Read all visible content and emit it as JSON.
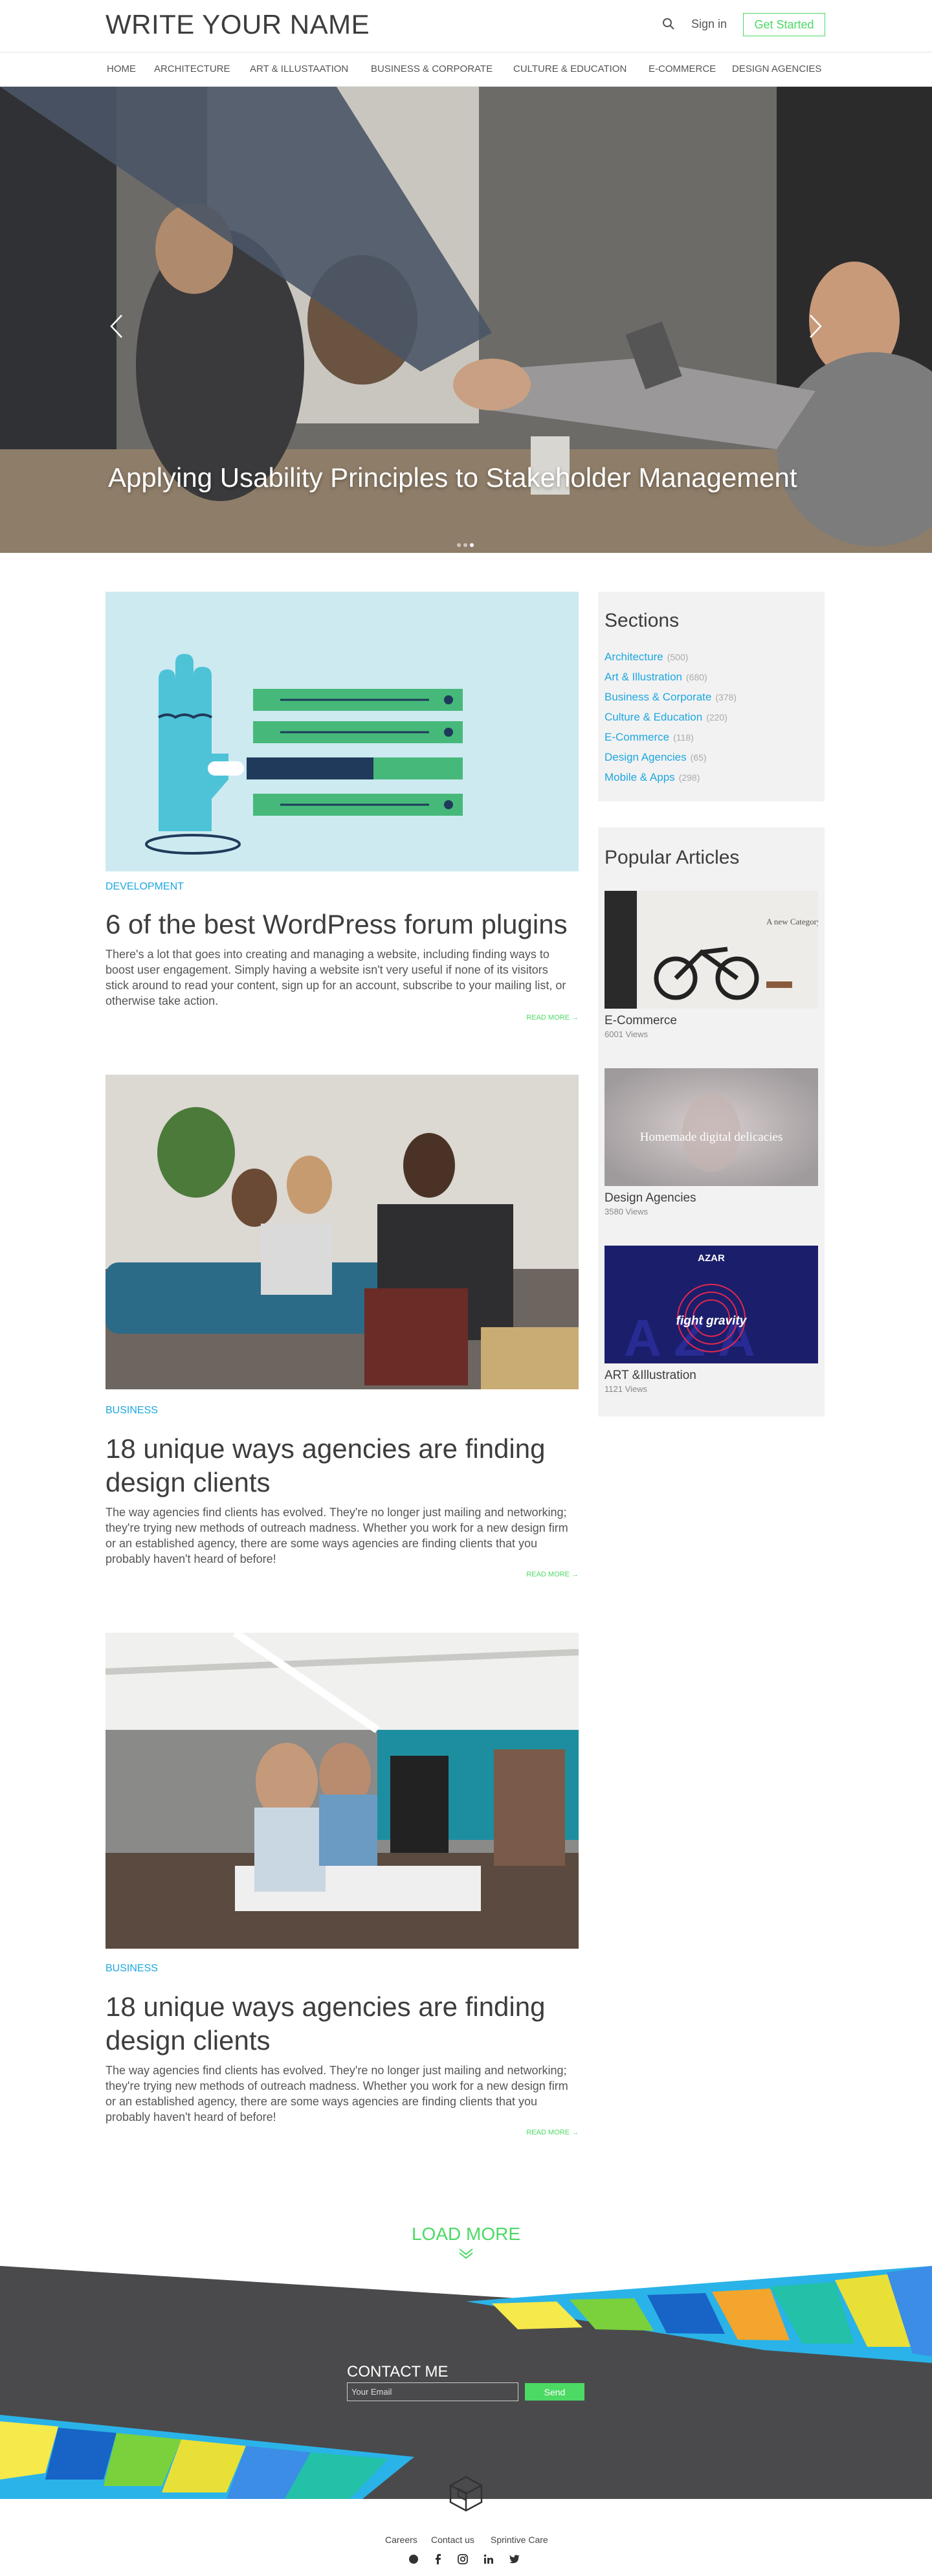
{
  "header": {
    "logo": "WRITE YOUR NAME",
    "signin": "Sign in",
    "get_started": "Get Started"
  },
  "nav": [
    "HOME",
    "ARCHITECTURE",
    "ART & ILLUSTAATION",
    "BUSINESS & CORPORATE",
    "CULTURE & EDUCATION",
    "E-COMMERCE",
    "DESIGN AGENCIES"
  ],
  "hero": {
    "title": "Applying Usability Principles to Stakeholder Management",
    "slides": 3,
    "active_slide": 2
  },
  "articles": [
    {
      "category": "DEVELOPMENT",
      "title": "6 of the best WordPress forum plugins",
      "excerpt": "There's a lot that goes into creating and managing a website, including finding ways to boost user engagement. Simply having a website isn't very useful if none of its visitors stick around to read your content, sign up for an account, subscribe to your mailing list, or otherwise take action.",
      "read_more": "READ MORE →"
    },
    {
      "category": "BUSINESS",
      "title": "18 unique ways agencies are finding design clients",
      "excerpt": "The way agencies find clients has evolved. They're no longer just mailing and networking; they're trying new methods of outreach madness. Whether you work for a new design firm or an established agency, there are some ways agencies are finding clients that you probably haven't heard of before!",
      "read_more": "READ MORE →"
    },
    {
      "category": "BUSINESS",
      "title": "18 unique ways agencies are finding design clients",
      "excerpt": "The way agencies find clients has evolved. They're no longer just mailing and networking; they're trying new methods of outreach madness. Whether you work for a new design firm or an established agency, there are some ways agencies are finding clients that you probably haven't heard of before!",
      "read_more": "READ MORE →"
    }
  ],
  "sections": {
    "title": "Sections",
    "items": [
      {
        "label": "Architecture",
        "count": "(500)"
      },
      {
        "label": "Art & Illustration",
        "count": "(680)"
      },
      {
        "label": "Business & Corporate",
        "count": "(378)"
      },
      {
        "label": "Culture & Education",
        "count": "(220)"
      },
      {
        "label": "E-Commerce",
        "count": "(118)"
      },
      {
        "label": "Design Agencies",
        "count": "(65)"
      },
      {
        "label": "Mobile & Apps",
        "count": "(298)"
      }
    ]
  },
  "popular": {
    "title": "Popular Articles",
    "items": [
      {
        "name": "E-Commerce",
        "views": "6001 Views",
        "thumb_text": "A new Category e-bike"
      },
      {
        "name": "Design Agencies",
        "views": "3580 Views",
        "thumb_text": "Homemade digital delicacies"
      },
      {
        "name": "ART &Illustration",
        "views": "1121 Views",
        "thumb_brand": "AZAR",
        "thumb_text": "fight gravity"
      }
    ]
  },
  "load_more": "LOAD MORE",
  "footer": {
    "contact_title": "CONTACT ME",
    "email_placeholder": "Your Email",
    "send": "Send",
    "links": [
      "Careers",
      "Contact us",
      "Sprintive Care"
    ]
  },
  "colors": {
    "accent_green": "#4cd964",
    "link_blue": "#1ea7e0",
    "footer_dark": "#4a4a4c"
  }
}
